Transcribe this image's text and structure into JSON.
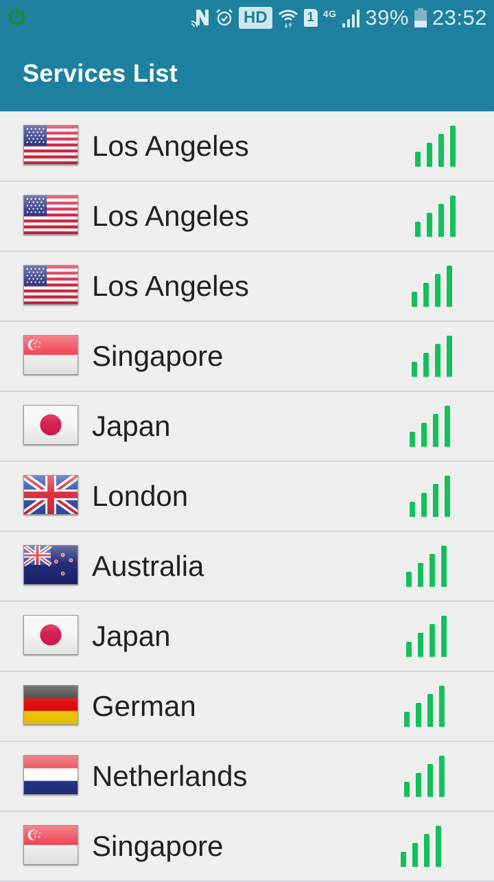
{
  "status_bar": {
    "icons": [
      "power-icon",
      "nfc-n-icon",
      "alarm-icon",
      "hd-voice-icon",
      "wifi-icon",
      "sim-1-icon",
      "4g-icon",
      "cell-signal-icon",
      "battery-icon"
    ],
    "hd_label": "HD",
    "sim_label": "1",
    "network_label": "4G",
    "battery_percent": "39%",
    "battery_level": 0.39,
    "time": "23:52"
  },
  "app_bar": {
    "title": "Services List"
  },
  "colors": {
    "primary": "#1e809f",
    "signal_green": "#14c05a",
    "list_background": "#efeff0",
    "divider": "#d6d6d8"
  },
  "servers": [
    {
      "name": "Los Angeles",
      "flag": "us",
      "signal_bars": 4
    },
    {
      "name": "Los Angeles",
      "flag": "us",
      "signal_bars": 4
    },
    {
      "name": "Los Angeles",
      "flag": "us",
      "signal_bars": 4
    },
    {
      "name": "Singapore",
      "flag": "sg",
      "signal_bars": 4
    },
    {
      "name": "Japan",
      "flag": "jp",
      "signal_bars": 4
    },
    {
      "name": "London",
      "flag": "gb",
      "signal_bars": 4
    },
    {
      "name": "Australia",
      "flag": "au",
      "signal_bars": 4
    },
    {
      "name": "Japan",
      "flag": "jp",
      "signal_bars": 4
    },
    {
      "name": "German",
      "flag": "de",
      "signal_bars": 4
    },
    {
      "name": "Netherlands",
      "flag": "nl",
      "signal_bars": 4
    },
    {
      "name": "Singapore",
      "flag": "sg",
      "signal_bars": 4
    }
  ]
}
